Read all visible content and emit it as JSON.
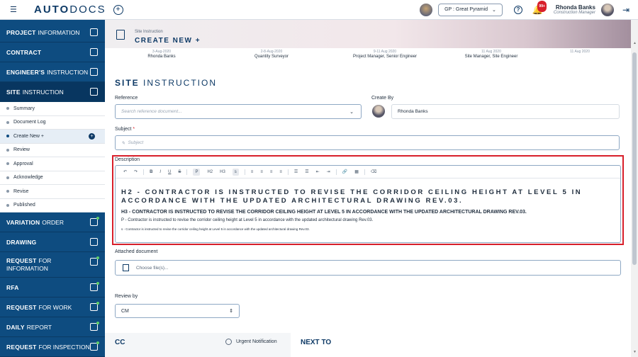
{
  "app": {
    "logo_bold": "AUTO",
    "logo_rest": "DOCS"
  },
  "topbar": {
    "project": "GP : Great Pyramid",
    "notif_badge": "99+",
    "user_name": "Rhonda Banks",
    "user_role": "Construction Manager"
  },
  "sidebar": {
    "project": {
      "bold": "PROJECT",
      "rest": "INFORMATION"
    },
    "contract": {
      "bold": "CONTRACT",
      "rest": ""
    },
    "engineer": {
      "bold": "ENGINEER'S",
      "rest": "INSTRUCTION"
    },
    "site": {
      "bold": "SITE",
      "rest": "INSTRUCTION"
    },
    "sub": [
      "Summary",
      "Document Log",
      "Create New +",
      "Review",
      "Approval",
      "Acknowledge",
      "Revise",
      "Published"
    ],
    "variation": {
      "bold": "VARIATION",
      "rest": "ORDER"
    },
    "drawing": {
      "bold": "DRAWING",
      "rest": ""
    },
    "rfi": {
      "bold": "REQUEST",
      "rest": "FOR",
      "line2": "INFORMATION"
    },
    "rfa": {
      "bold": "RFA",
      "rest": ""
    },
    "rfw": {
      "bold": "REQUEST",
      "rest": "FOR WORK"
    },
    "daily": {
      "bold": "DAILY",
      "rest": "REPORT"
    },
    "rfin": {
      "bold": "REQUEST",
      "rest": "FOR INSPECTION"
    }
  },
  "banner": {
    "sub": "Site Instruction",
    "title": "CREATE NEW +"
  },
  "strip": [
    {
      "date": "3-Aug-2020",
      "value": "Rhonda Banks"
    },
    {
      "date": "2-8-Aug-2020",
      "value": "Quantity Surveyor"
    },
    {
      "date": "9-11 Aug 2020",
      "value": "Project Manager, Senior Engineer"
    },
    {
      "date": "11 Aug 2020",
      "value": "Site Manager, Site Engineer"
    },
    {
      "date": "11 Aug 2020",
      "value": ""
    }
  ],
  "form": {
    "section_bold": "SITE",
    "section_rest": "INSTRUCTION",
    "reference_label": "Reference",
    "reference_placeholder": "Search reference document...",
    "createby_label": "Create By",
    "createby_value": "Rhonda Banks",
    "subject_label": "Subject",
    "subject_required": "*",
    "subject_placeholder": "Subject",
    "description_label": "Description",
    "toolbar": [
      "↶",
      "↷",
      "B",
      "I",
      "U",
      "S",
      "P",
      "H2",
      "H3",
      "s",
      "≡",
      "≡",
      "≡",
      "≡",
      "☰",
      "☰",
      "⇤",
      "⇥",
      "🔗",
      "▦",
      "⌫"
    ],
    "h2_text": "H2 - CONTRACTOR IS INSTRUCTED TO REVISE THE CORRIDOR CEILING HEIGHT AT LEVEL 5 IN ACCORDANCE WITH THE UPDATED ARCHITECTURAL DRAWING REV.03.",
    "h3_text": "H3 - CONTRACTOR IS INSTRUCTED TO REVISE THE CORRIDOR CEILING HEIGHT AT LEVEL 5 IN ACCORDANCE WITH THE UPDATED ARCHITECTURAL DRAWING REV.03.",
    "p_text": "P - Contractor is instructed to revise the corridor ceiling height at Level 5 in accordance with the updated architectural drawing Rev.03.",
    "s_text": "s - Contractor is instructed to revise the corridor ceiling height at Level 5 in accordance with the updated architectural drawing Rev.03.",
    "attached_label": "Attached document",
    "attached_placeholder": "Choose file(s)...",
    "review_label": "Review by",
    "review_value": "CM"
  },
  "bottom": {
    "cc": "CC",
    "urgent": "Urgent Notification",
    "next": "NEXT TO"
  },
  "colors": {
    "primary": "#0e4c80",
    "highlight": "#d81f2a"
  }
}
